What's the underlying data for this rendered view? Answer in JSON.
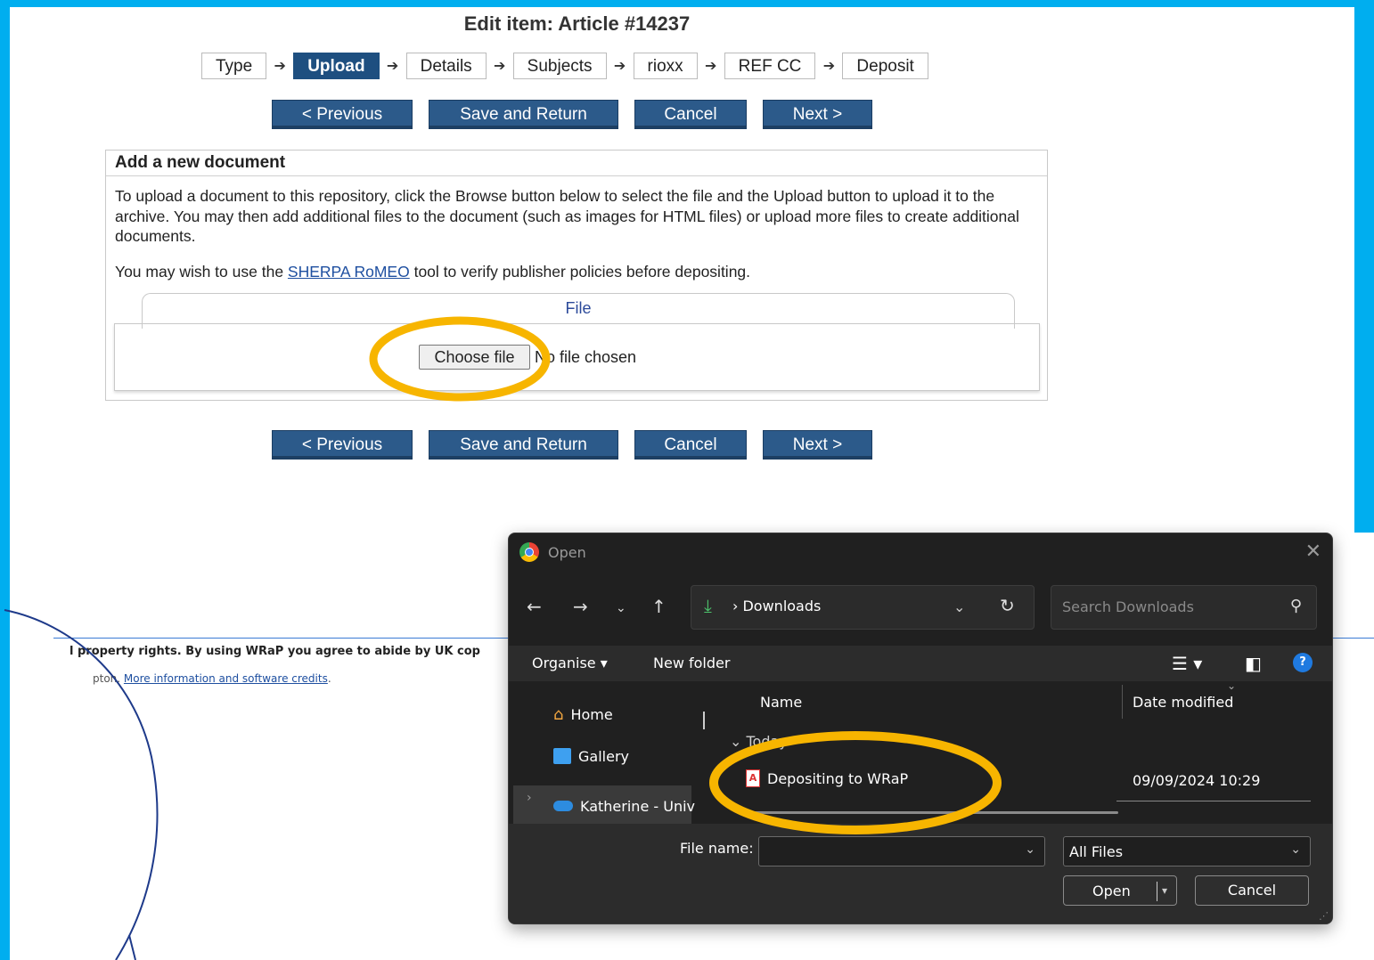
{
  "page": {
    "title": "Edit item: Article #14237"
  },
  "steps": [
    {
      "label": "Type",
      "active": false
    },
    {
      "label": "Upload",
      "active": true
    },
    {
      "label": "Details",
      "active": false
    },
    {
      "label": "Subjects",
      "active": false
    },
    {
      "label": "rioxx",
      "active": false
    },
    {
      "label": "REF CC",
      "active": false
    },
    {
      "label": "Deposit",
      "active": false
    }
  ],
  "buttons": {
    "previous": "< Previous",
    "save_return": "Save and Return",
    "cancel": "Cancel",
    "next": "Next >"
  },
  "panel": {
    "heading": "Add a new document",
    "instructions": "To upload a document to this repository, click the Browse button below to select the file and the Upload button to upload it to the archive. You may then add additional files to the document (such as images for HTML files) or upload more files to create additional documents.",
    "sherpa_prefix": "You may wish to use the ",
    "sherpa_link": "SHERPA RoMEO",
    "sherpa_suffix": " tool to verify publisher policies before depositing.",
    "file_tab": "File",
    "choose_file": "Choose file",
    "no_file": "No file chosen"
  },
  "footer": {
    "line1": "l property rights. By using WRaP you agree to abide by UK cop",
    "line2_prefix": "pton. ",
    "line2_link": "More information and software credits",
    "line2_suffix": "."
  },
  "dialog": {
    "title": "Open",
    "path": "Downloads",
    "search_placeholder": "Search Downloads",
    "organise": "Organise ▾",
    "new_folder": "New folder",
    "sidebar": [
      "Home",
      "Gallery",
      "Katherine - Univ"
    ],
    "col_name": "Name",
    "col_date": "Date modified",
    "group": "Today",
    "file": {
      "name": "Depositing to WRaP",
      "date": "09/09/2024 10:29"
    },
    "file_name_label": "File name:",
    "file_name_value": "",
    "file_type": "All Files",
    "open": "Open",
    "cancel": "Cancel"
  },
  "colors": {
    "frame": "#00aeef",
    "button": "#2c5a8a",
    "highlight": "#f7b500",
    "circle": "#1e3a8a"
  },
  "icons": [
    "back-arrow-icon",
    "forward-arrow-icon",
    "up-arrow-icon",
    "download-icon",
    "refresh-icon",
    "search-icon",
    "close-icon",
    "home-icon",
    "gallery-icon",
    "cloud-icon",
    "pdf-icon",
    "help-icon"
  ]
}
